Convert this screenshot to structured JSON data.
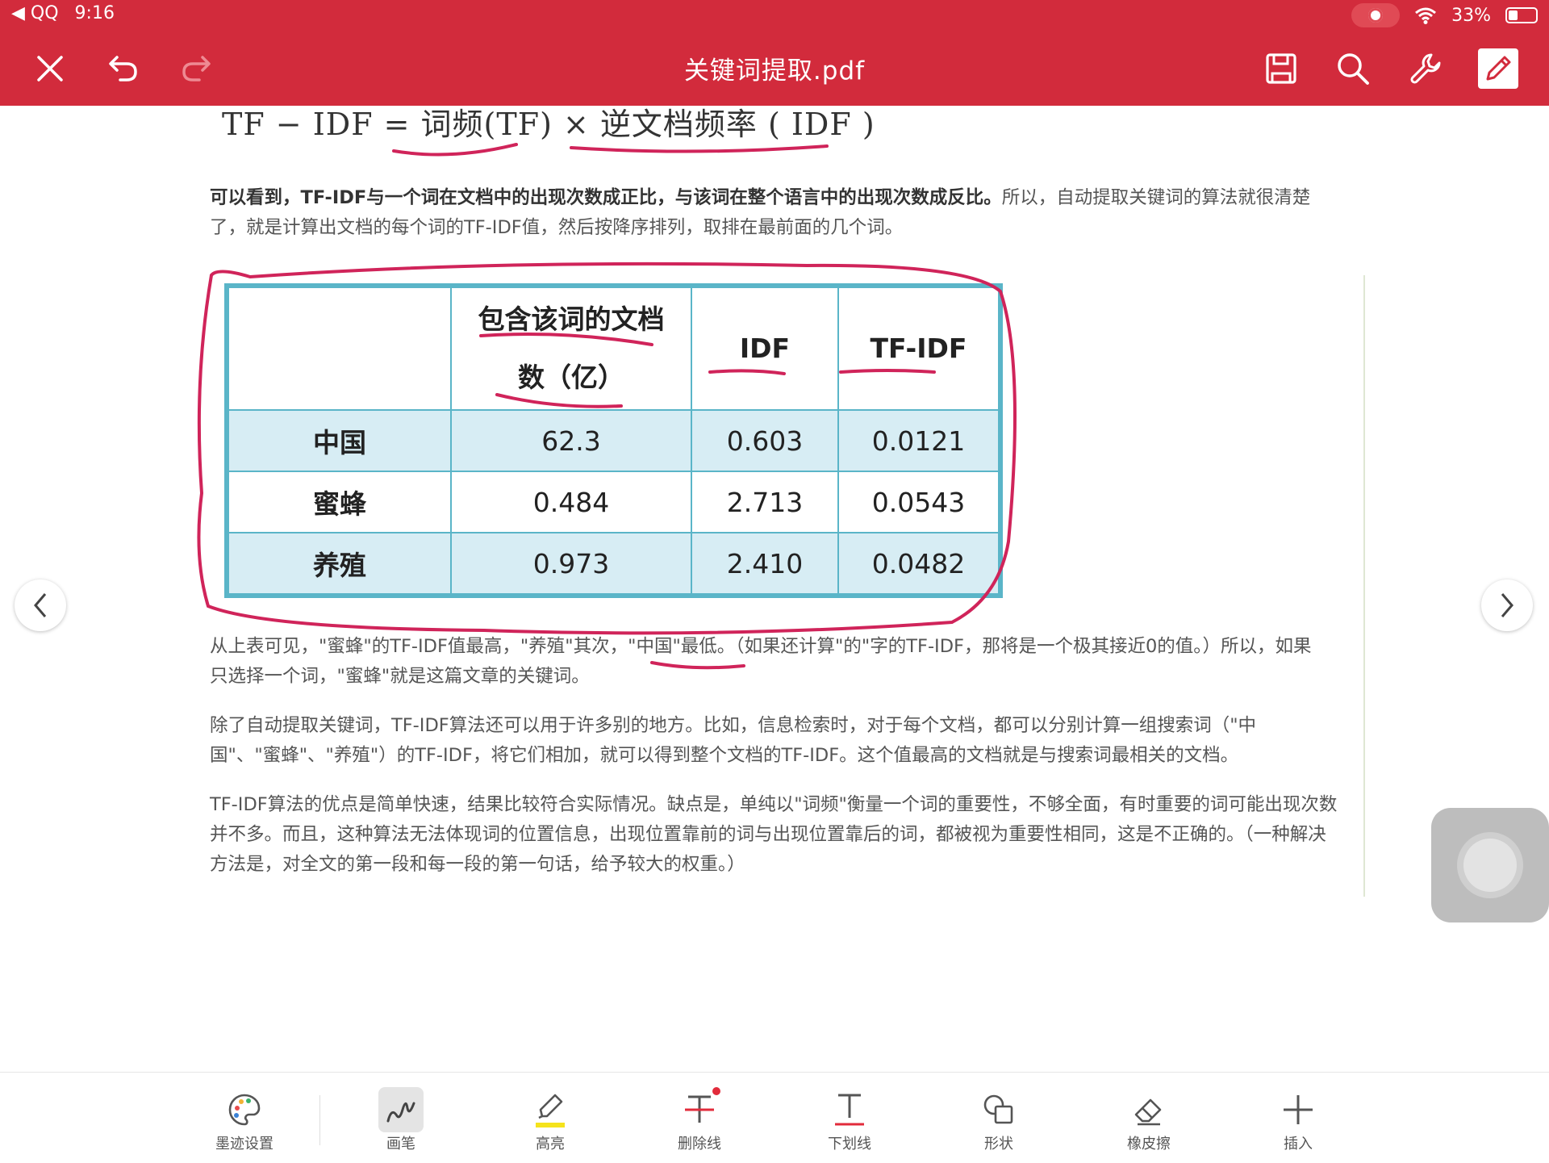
{
  "status_bar": {
    "back_app": "◀ QQ",
    "time": "9:16",
    "battery_text": "33%",
    "battery_level": 0.33
  },
  "header": {
    "title": "关键词提取.pdf",
    "background": "#d22b3c"
  },
  "document": {
    "formula": "TF − IDF = 词频(TF) × 逆文档频率 ( IDF )",
    "intro_bold": "可以看到，TF-IDF与一个词在文档中的出现次数成正比，与该词在整个语言中的出现次数成反比。",
    "intro_rest": "所以，自动提取关键词的算法就很清楚了，就是计算出文档的每个词的TF-IDF值，然后按降序排列，取排在最前面的几个词。",
    "table": {
      "headers": [
        "",
        "包含该词的文档数（亿）",
        "IDF",
        "TF-IDF"
      ],
      "rows": [
        {
          "word": "中国",
          "docs": "62.3",
          "idf": "0.603",
          "tfidf": "0.0121"
        },
        {
          "word": "蜜蜂",
          "docs": "0.484",
          "idf": "2.713",
          "tfidf": "0.0543"
        },
        {
          "word": "养殖",
          "docs": "0.973",
          "idf": "2.410",
          "tfidf": "0.0482"
        }
      ]
    },
    "para1": "从上表可见，\"蜜蜂\"的TF-IDF值最高，\"养殖\"其次，\"中国\"最低。（如果还计算\"的\"字的TF-IDF，那将是一个极其接近0的值。）所以，如果只选择一个词，\"蜜蜂\"就是这篇文章的关键词。",
    "para2": "除了自动提取关键词，TF-IDF算法还可以用于许多别的地方。比如，信息检索时，对于每个文档，都可以分别计算一组搜索词（\"中国\"、\"蜜蜂\"、\"养殖\"）的TF-IDF，将它们相加，就可以得到整个文档的TF-IDF。这个值最高的文档就是与搜索词最相关的文档。",
    "para3": "TF-IDF算法的优点是简单快速，结果比较符合实际情况。缺点是，单纯以\"词频\"衡量一个词的重要性，不够全面，有时重要的词可能出现次数并不多。而且，这种算法无法体现词的位置信息，出现位置靠前的词与出现位置靠后的词，都被视为重要性相同，这是不正确的。（一种解决方法是，对全文的第一段和每一段的第一句话，给予较大的权重。）",
    "ink_color": "#d0245a",
    "table_border_color": "#5ab5c8",
    "table_shade_color": "#d7edf4"
  },
  "toolbar": {
    "tools": [
      {
        "label": "墨迹设置",
        "icon": "palette-icon"
      },
      {
        "label": "画笔",
        "icon": "pen-icon",
        "active": true
      },
      {
        "label": "高亮",
        "icon": "highlighter-icon"
      },
      {
        "label": "删除线",
        "icon": "strikethrough-icon"
      },
      {
        "label": "下划线",
        "icon": "underline-icon"
      },
      {
        "label": "形状",
        "icon": "shapes-icon"
      },
      {
        "label": "橡皮擦",
        "icon": "eraser-icon"
      },
      {
        "label": "插入",
        "icon": "plus-icon"
      }
    ]
  }
}
